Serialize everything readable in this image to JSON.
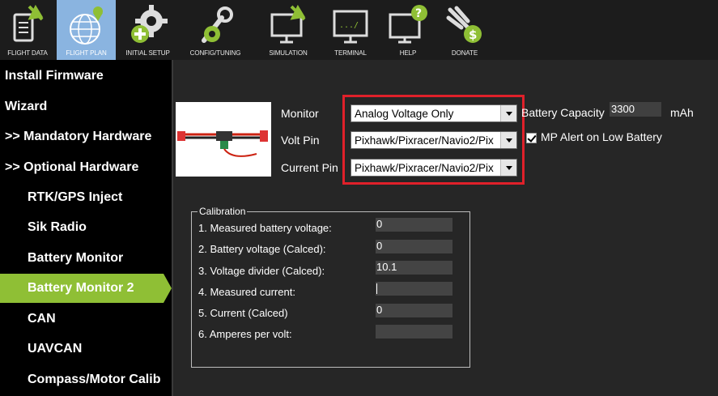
{
  "toolbar": {
    "items": [
      {
        "label": "FLIGHT DATA",
        "icon": "flight-data-icon"
      },
      {
        "label": "FLIGHT PLAN",
        "icon": "flight-plan-globe-icon"
      },
      {
        "label": "INITIAL SETUP",
        "icon": "initial-setup-gear-icon"
      },
      {
        "label": "CONFIG/TUNING",
        "icon": "config-wrench-icon"
      },
      {
        "label": "SIMULATION",
        "icon": "simulation-monitor-icon"
      },
      {
        "label": "TERMINAL",
        "icon": "terminal-icon"
      },
      {
        "label": "HELP",
        "icon": "help-icon"
      },
      {
        "label": "DONATE",
        "icon": "donate-icon"
      }
    ]
  },
  "sidebar": {
    "items": [
      {
        "label": "Install Firmware"
      },
      {
        "label": "Wizard"
      },
      {
        "label": ">> Mandatory Hardware"
      },
      {
        "label": ">> Optional Hardware"
      },
      {
        "label": "RTK/GPS Inject"
      },
      {
        "label": "Sik Radio"
      },
      {
        "label": "Battery Monitor"
      },
      {
        "label": "Battery Monitor 2"
      },
      {
        "label": "CAN"
      },
      {
        "label": "UAVCAN"
      },
      {
        "label": "Compass/Motor Calib"
      }
    ]
  },
  "form": {
    "monitor_label": "Monitor",
    "monitor_value": "Analog Voltage Only",
    "volt_pin_label": "Volt Pin",
    "volt_pin_value": "Pixhawk/Pixracer/Navio2/Pix",
    "current_pin_label": "Current Pin",
    "current_pin_value": "Pixhawk/Pixracer/Navio2/Pix",
    "battery_capacity_label": "Battery Capacity",
    "battery_capacity_value": "3300",
    "battery_capacity_unit": "mAh",
    "mp_alert_label": "MP Alert on Low Battery"
  },
  "calibration": {
    "title": "Calibration",
    "rows": [
      {
        "label": "1. Measured battery voltage:",
        "value": "0"
      },
      {
        "label": "2. Battery voltage (Calced):",
        "value": "0"
      },
      {
        "label": "3. Voltage divider (Calced):",
        "value": "10.1"
      },
      {
        "label": "4. Measured current:",
        "value": ""
      },
      {
        "label": "5. Current (Calced)",
        "value": "0"
      },
      {
        "label": "6. Amperes per volt:",
        "value": ""
      }
    ]
  },
  "colors": {
    "highlight": "#e0202a",
    "active_nav": "#8fbf35",
    "active_tab": "#8ab4e0"
  }
}
